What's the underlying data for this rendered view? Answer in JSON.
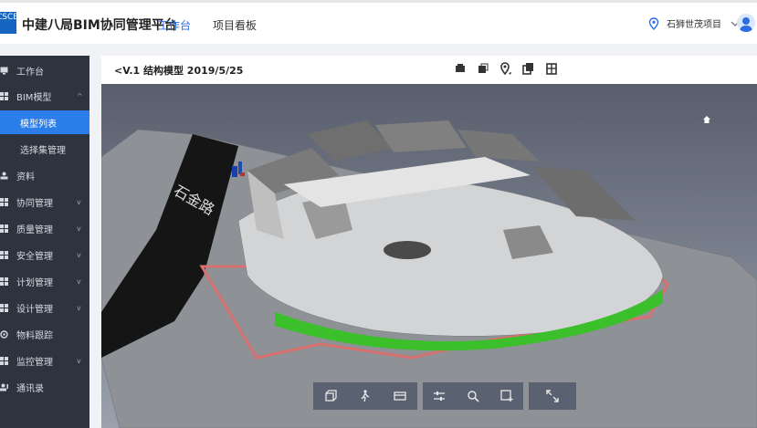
{
  "app": {
    "logo_text": "CSCEC",
    "title": "中建八局BIM协同管理平台"
  },
  "nav": {
    "tabs": [
      "工作台",
      "项目看板"
    ],
    "active": "工作台"
  },
  "header": {
    "project": "石狮世茂项目"
  },
  "sidebar": {
    "items": [
      {
        "label": "工作台",
        "icon": "monitor-icon"
      },
      {
        "label": "BIM模型",
        "icon": "grid-icon",
        "chevron": "^"
      },
      {
        "label": "模型列表",
        "sub": true,
        "active": true
      },
      {
        "label": "选择集管理",
        "sub": true
      },
      {
        "label": "资料",
        "icon": "person-icon"
      },
      {
        "label": "协同管理",
        "icon": "grid-icon",
        "chevron": "v"
      },
      {
        "label": "质量管理",
        "icon": "grid-icon",
        "chevron": "v"
      },
      {
        "label": "安全管理",
        "icon": "grid-icon",
        "chevron": "v"
      },
      {
        "label": "计划管理",
        "icon": "grid-icon",
        "chevron": "v"
      },
      {
        "label": "设计管理",
        "icon": "grid-icon",
        "chevron": "v"
      },
      {
        "label": "物料跟踪",
        "icon": "tracking-icon"
      },
      {
        "label": "监控管理",
        "icon": "grid-icon",
        "chevron": "v"
      },
      {
        "label": "通讯录",
        "icon": "contacts-icon"
      }
    ]
  },
  "model": {
    "back_label": "V.1 结构模型 2019/5/25",
    "road_label": "石金路",
    "toolbar_icons": [
      "layers-icon",
      "cube-icon",
      "location-icon",
      "copy-icon",
      "building-icon"
    ],
    "bottom_groups": [
      [
        "cube-view-icon",
        "walk-icon",
        "section-icon"
      ],
      [
        "settings-icon",
        "zoom-icon",
        "add-view-icon"
      ],
      [
        "fullscreen-icon"
      ]
    ]
  },
  "colors": {
    "accent": "#2b6de3",
    "sidebar_bg": "#2e3340",
    "active_item": "#2b7de9",
    "viewport_bg": "#7f8794"
  }
}
